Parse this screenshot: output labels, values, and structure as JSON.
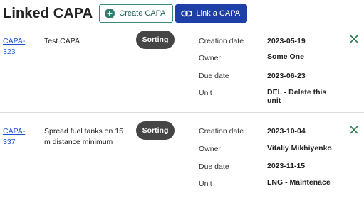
{
  "header": {
    "title": "Linked CAPA",
    "create_label": "Create CAPA",
    "link_label": "Link a CAPA"
  },
  "colors": {
    "primary": "#1f3fa8",
    "teal": "#2f7d70",
    "badge": "#454545",
    "link": "#1a55d6",
    "close": "#2e7d4f"
  },
  "field_labels": [
    "Creation date",
    "Owner",
    "Due date",
    "Unit"
  ],
  "items": [
    {
      "capa_id": "CAPA-323",
      "title": "Test CAPA",
      "status": "Sorting",
      "creation_date": "2023-05-19",
      "owner": "Some One",
      "due_date": "2023-06-23",
      "unit": "DEL - Delete this unit"
    },
    {
      "capa_id": "CAPA-337",
      "title": "Spread fuel tanks on 15 m distance minimum",
      "status": "Sorting",
      "creation_date": "2023-10-04",
      "owner": "Vitaliy Mikhiyenko",
      "due_date": "2023-11-15",
      "unit": "LNG - Maintenace"
    }
  ]
}
